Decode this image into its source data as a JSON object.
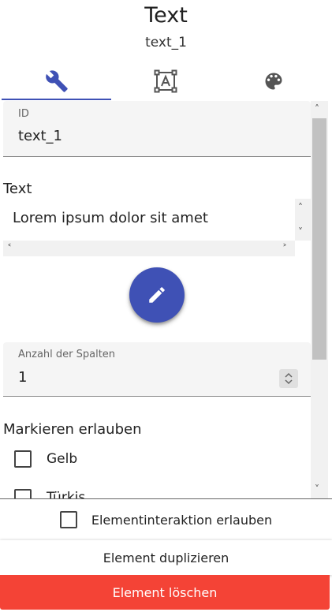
{
  "header": {
    "title": "Text",
    "subtitle": "text_1"
  },
  "tabs": [
    {
      "name": "wrench-icon",
      "active": true
    },
    {
      "name": "text-frame-icon",
      "active": false
    },
    {
      "name": "palette-icon",
      "active": false
    }
  ],
  "colors": {
    "accent": "#3f51b5",
    "danger": "#f44336"
  },
  "fields": {
    "id": {
      "label": "ID",
      "value": "text_1"
    },
    "text_section_label": "Text",
    "text_value": "Lorem ipsum dolor sit amet",
    "columns": {
      "label": "Anzahl der Spalten",
      "value": "1"
    },
    "highlight_section_label": "Markieren erlauben",
    "highlight_options": [
      "Gelb",
      "Türkis"
    ]
  },
  "footer": {
    "interaction_label": "Elementinteraktion erlauben",
    "duplicate_label": "Element duplizieren",
    "delete_label": "Element löschen"
  }
}
